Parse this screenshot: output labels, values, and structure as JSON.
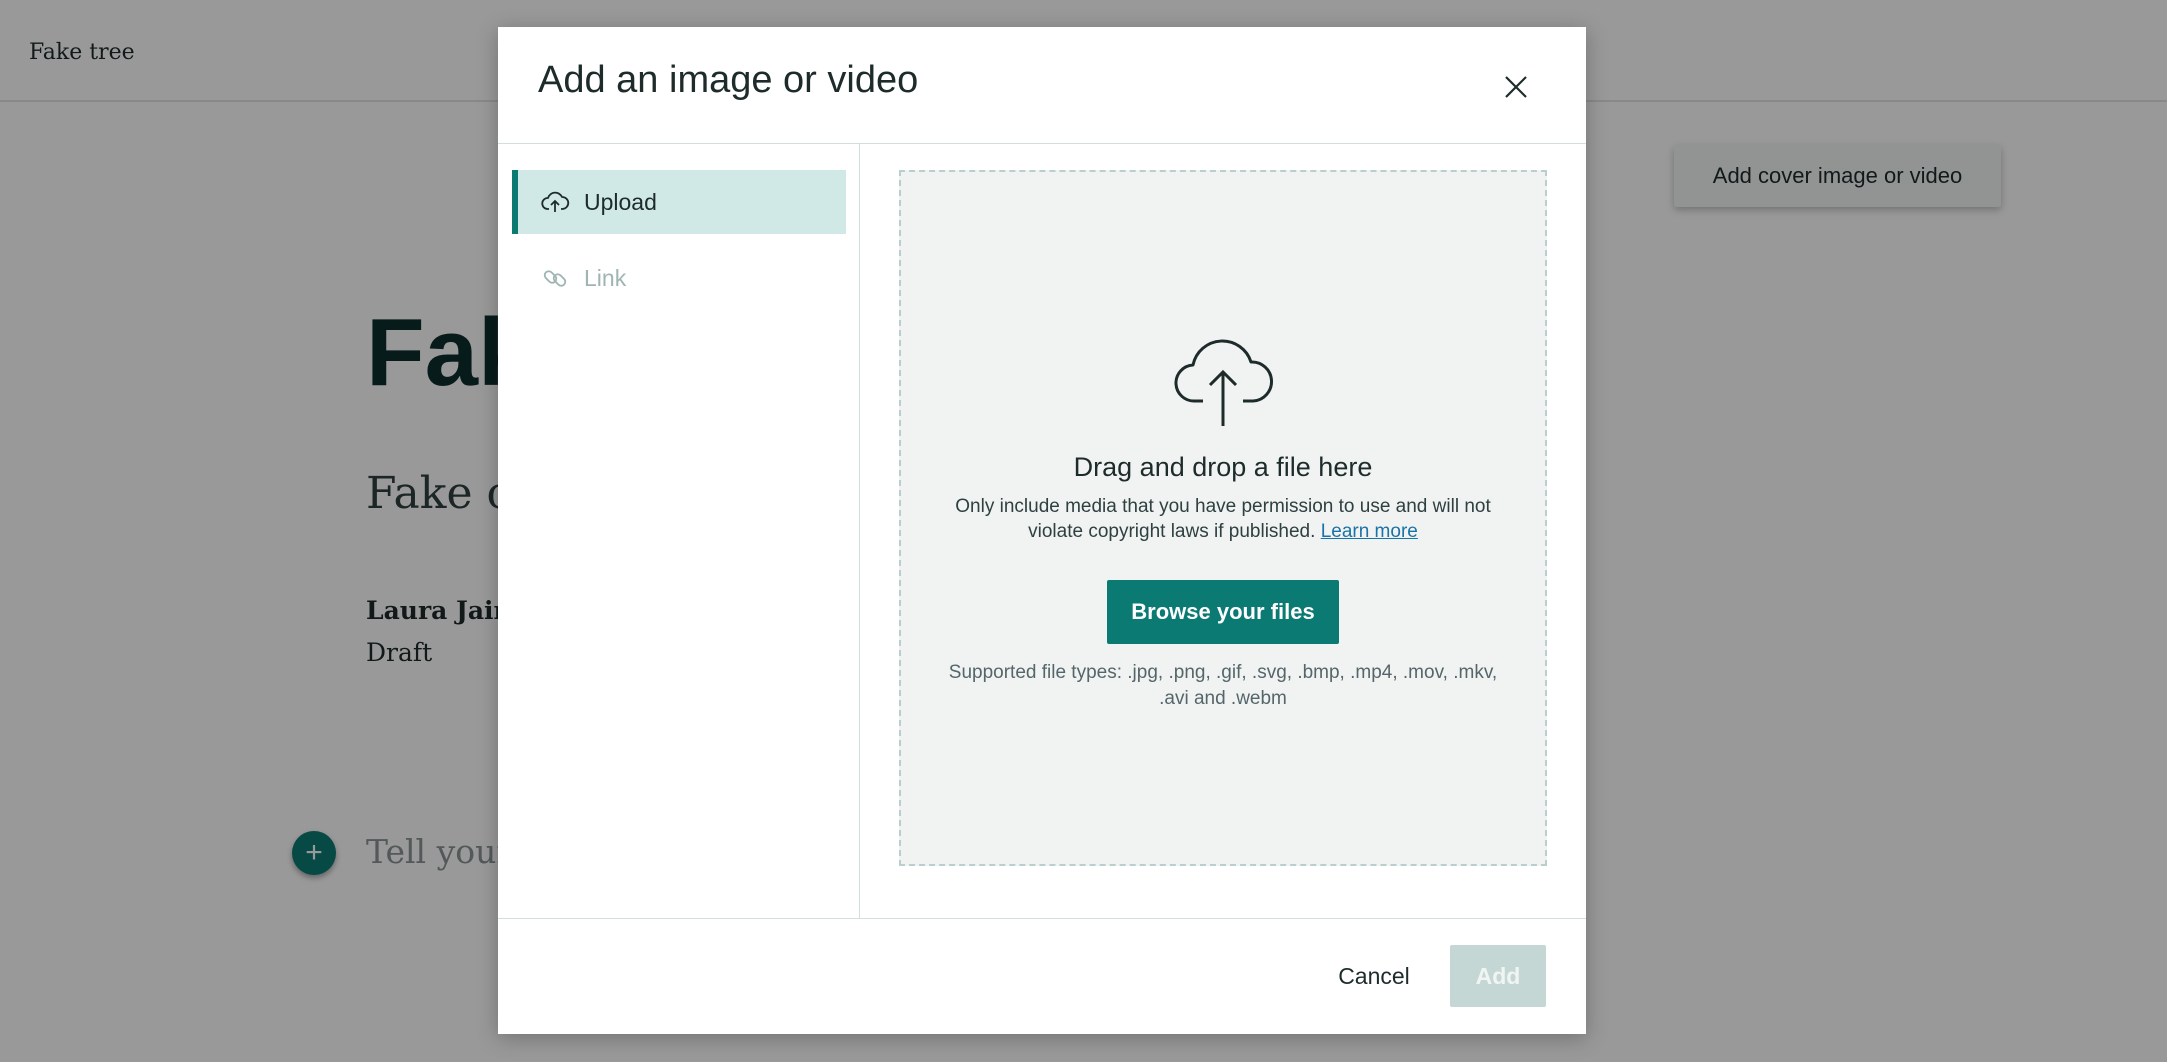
{
  "background": {
    "site_name": "Fake tree",
    "cover_button": "Add cover image or video",
    "story_title": "Fak",
    "story_subtitle": "Fake c",
    "author": "Laura Jain",
    "status": "Draft",
    "body_placeholder": "Tell your",
    "add_block_symbol": "+"
  },
  "modal": {
    "title": "Add an image or video",
    "close_icon": "close-icon",
    "tabs": [
      {
        "label": "Upload",
        "icon": "cloud-upload-icon",
        "selected": true
      },
      {
        "label": "Link",
        "icon": "link-icon",
        "selected": false
      }
    ],
    "dropzone": {
      "icon": "cloud-upload-icon",
      "heading": "Drag and drop a file here",
      "note": "Only include media that you have permission to use and will not violate copyright laws if published.",
      "learn_more": "Learn more",
      "browse_button": "Browse your files",
      "supported_types": "Supported file types: .jpg, .png, .gif, .svg, .bmp, .mp4, .mov, .mkv, .avi and .webm"
    },
    "footer": {
      "cancel": "Cancel",
      "add": "Add"
    }
  },
  "colors": {
    "accent": "#0b7a73",
    "selected_tab_bg": "#d0e9e6",
    "link_blue": "#1a73a8",
    "disabled_button": "#c5d7d5"
  }
}
